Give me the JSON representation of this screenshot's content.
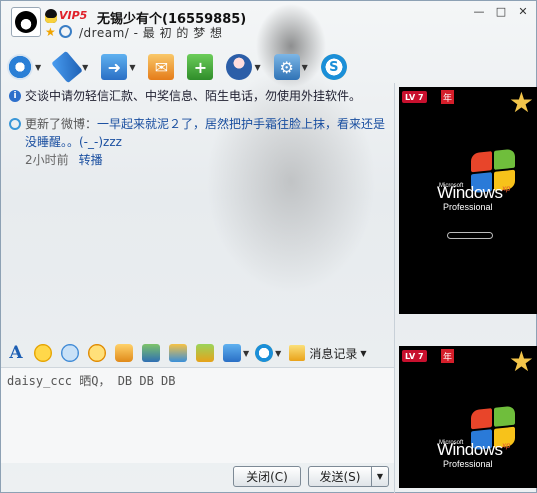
{
  "title_bar": {
    "vip_label": "VIP5",
    "contact_name": "无锡少有个(16559885)",
    "signature": "/dream/ -        最 初 的 梦 想",
    "min_label": "—",
    "max_label": "□",
    "close_label": "✕"
  },
  "toolbar": {
    "items": [
      {
        "icon": "video-camera-icon",
        "has_dropdown": true
      },
      {
        "icon": "microphone-icon",
        "has_dropdown": true
      },
      {
        "icon": "send-file-icon",
        "has_dropdown": true
      },
      {
        "icon": "email-icon",
        "has_dropdown": false
      },
      {
        "icon": "app-add-icon",
        "has_dropdown": false
      },
      {
        "icon": "contact-info-icon",
        "has_dropdown": true
      },
      {
        "icon": "settings-icon",
        "has_dropdown": true
      },
      {
        "icon": "soso-icon",
        "has_dropdown": false
      }
    ]
  },
  "messages": {
    "security_notice": "交谈中请勿轻信汇款、中奖信息、陌生电话，勿使用外挂软件。",
    "weibo_prefix": "更新了微博：",
    "weibo_text": "一早起来就泥２了，居然把护手霜往脸上抹，看来还是没睡醒。。(-_-)zzz",
    "weibo_time": "2小时前",
    "weibo_forward": "转播"
  },
  "input_toolbar": {
    "font_label": "A",
    "history_label": "消息记录"
  },
  "input": {
    "text": "daisy_ccc   晒Q，  DB DB DB"
  },
  "buttons": {
    "close_label": "关闭(C)",
    "send_label": "发送(S)",
    "send_arrow": "▼"
  },
  "ads": {
    "level_badge": "LV 7",
    "year_badge": "年",
    "microsoft": "Microsoft",
    "windows": "Windows",
    "xp": "xp",
    "professional": "Professional"
  },
  "colors": {
    "accent": "#1a4fa0",
    "vip": "#e0202a"
  }
}
